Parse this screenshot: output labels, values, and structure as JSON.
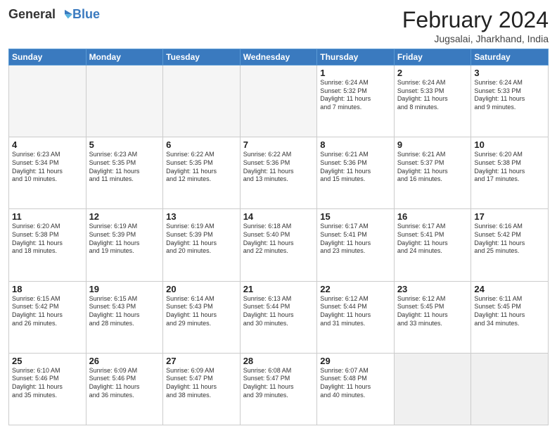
{
  "header": {
    "logo_general": "General",
    "logo_blue": "Blue",
    "title": "February 2024",
    "location": "Jugsalai, Jharkhand, India"
  },
  "days_of_week": [
    "Sunday",
    "Monday",
    "Tuesday",
    "Wednesday",
    "Thursday",
    "Friday",
    "Saturday"
  ],
  "weeks": [
    [
      {
        "day": "",
        "info": "",
        "empty": true
      },
      {
        "day": "",
        "info": "",
        "empty": true
      },
      {
        "day": "",
        "info": "",
        "empty": true
      },
      {
        "day": "",
        "info": "",
        "empty": true
      },
      {
        "day": "1",
        "info": "Sunrise: 6:24 AM\nSunset: 5:32 PM\nDaylight: 11 hours\nand 7 minutes.",
        "empty": false
      },
      {
        "day": "2",
        "info": "Sunrise: 6:24 AM\nSunset: 5:33 PM\nDaylight: 11 hours\nand 8 minutes.",
        "empty": false
      },
      {
        "day": "3",
        "info": "Sunrise: 6:24 AM\nSunset: 5:33 PM\nDaylight: 11 hours\nand 9 minutes.",
        "empty": false
      }
    ],
    [
      {
        "day": "4",
        "info": "Sunrise: 6:23 AM\nSunset: 5:34 PM\nDaylight: 11 hours\nand 10 minutes.",
        "empty": false
      },
      {
        "day": "5",
        "info": "Sunrise: 6:23 AM\nSunset: 5:35 PM\nDaylight: 11 hours\nand 11 minutes.",
        "empty": false
      },
      {
        "day": "6",
        "info": "Sunrise: 6:22 AM\nSunset: 5:35 PM\nDaylight: 11 hours\nand 12 minutes.",
        "empty": false
      },
      {
        "day": "7",
        "info": "Sunrise: 6:22 AM\nSunset: 5:36 PM\nDaylight: 11 hours\nand 13 minutes.",
        "empty": false
      },
      {
        "day": "8",
        "info": "Sunrise: 6:21 AM\nSunset: 5:36 PM\nDaylight: 11 hours\nand 15 minutes.",
        "empty": false
      },
      {
        "day": "9",
        "info": "Sunrise: 6:21 AM\nSunset: 5:37 PM\nDaylight: 11 hours\nand 16 minutes.",
        "empty": false
      },
      {
        "day": "10",
        "info": "Sunrise: 6:20 AM\nSunset: 5:38 PM\nDaylight: 11 hours\nand 17 minutes.",
        "empty": false
      }
    ],
    [
      {
        "day": "11",
        "info": "Sunrise: 6:20 AM\nSunset: 5:38 PM\nDaylight: 11 hours\nand 18 minutes.",
        "empty": false
      },
      {
        "day": "12",
        "info": "Sunrise: 6:19 AM\nSunset: 5:39 PM\nDaylight: 11 hours\nand 19 minutes.",
        "empty": false
      },
      {
        "day": "13",
        "info": "Sunrise: 6:19 AM\nSunset: 5:39 PM\nDaylight: 11 hours\nand 20 minutes.",
        "empty": false
      },
      {
        "day": "14",
        "info": "Sunrise: 6:18 AM\nSunset: 5:40 PM\nDaylight: 11 hours\nand 22 minutes.",
        "empty": false
      },
      {
        "day": "15",
        "info": "Sunrise: 6:17 AM\nSunset: 5:41 PM\nDaylight: 11 hours\nand 23 minutes.",
        "empty": false
      },
      {
        "day": "16",
        "info": "Sunrise: 6:17 AM\nSunset: 5:41 PM\nDaylight: 11 hours\nand 24 minutes.",
        "empty": false
      },
      {
        "day": "17",
        "info": "Sunrise: 6:16 AM\nSunset: 5:42 PM\nDaylight: 11 hours\nand 25 minutes.",
        "empty": false
      }
    ],
    [
      {
        "day": "18",
        "info": "Sunrise: 6:15 AM\nSunset: 5:42 PM\nDaylight: 11 hours\nand 26 minutes.",
        "empty": false
      },
      {
        "day": "19",
        "info": "Sunrise: 6:15 AM\nSunset: 5:43 PM\nDaylight: 11 hours\nand 28 minutes.",
        "empty": false
      },
      {
        "day": "20",
        "info": "Sunrise: 6:14 AM\nSunset: 5:43 PM\nDaylight: 11 hours\nand 29 minutes.",
        "empty": false
      },
      {
        "day": "21",
        "info": "Sunrise: 6:13 AM\nSunset: 5:44 PM\nDaylight: 11 hours\nand 30 minutes.",
        "empty": false
      },
      {
        "day": "22",
        "info": "Sunrise: 6:12 AM\nSunset: 5:44 PM\nDaylight: 11 hours\nand 31 minutes.",
        "empty": false
      },
      {
        "day": "23",
        "info": "Sunrise: 6:12 AM\nSunset: 5:45 PM\nDaylight: 11 hours\nand 33 minutes.",
        "empty": false
      },
      {
        "day": "24",
        "info": "Sunrise: 6:11 AM\nSunset: 5:45 PM\nDaylight: 11 hours\nand 34 minutes.",
        "empty": false
      }
    ],
    [
      {
        "day": "25",
        "info": "Sunrise: 6:10 AM\nSunset: 5:46 PM\nDaylight: 11 hours\nand 35 minutes.",
        "empty": false
      },
      {
        "day": "26",
        "info": "Sunrise: 6:09 AM\nSunset: 5:46 PM\nDaylight: 11 hours\nand 36 minutes.",
        "empty": false
      },
      {
        "day": "27",
        "info": "Sunrise: 6:09 AM\nSunset: 5:47 PM\nDaylight: 11 hours\nand 38 minutes.",
        "empty": false
      },
      {
        "day": "28",
        "info": "Sunrise: 6:08 AM\nSunset: 5:47 PM\nDaylight: 11 hours\nand 39 minutes.",
        "empty": false
      },
      {
        "day": "29",
        "info": "Sunrise: 6:07 AM\nSunset: 5:48 PM\nDaylight: 11 hours\nand 40 minutes.",
        "empty": false
      },
      {
        "day": "",
        "info": "",
        "empty": true,
        "shaded": true
      },
      {
        "day": "",
        "info": "",
        "empty": true,
        "shaded": true
      }
    ]
  ]
}
